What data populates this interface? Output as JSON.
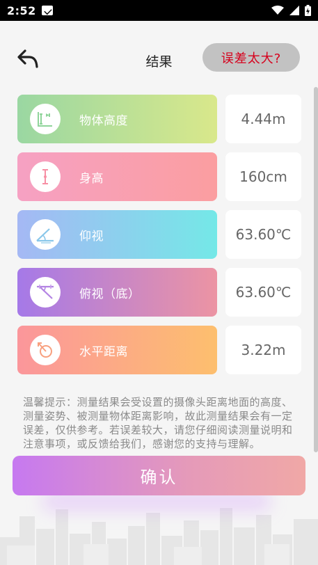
{
  "status_bar": {
    "time": "2:52",
    "icons": [
      "mail-icon",
      "wifi-icon",
      "signal-icon",
      "battery-icon"
    ]
  },
  "header": {
    "title": "结果",
    "error_button_label": "误差太大?",
    "back_icon": "back-arrow-icon"
  },
  "results": [
    {
      "label": "物体高度",
      "value": "4.44m",
      "icon": "object-height-icon"
    },
    {
      "label": "身高",
      "value": "160cm",
      "icon": "height-line-icon"
    },
    {
      "label": "仰视",
      "value": "63.60℃",
      "icon": "elevation-angle-icon"
    },
    {
      "label": "俯视（底）",
      "value": "63.60℃",
      "icon": "depression-angle-icon"
    },
    {
      "label": "水平距离",
      "value": "3.22m",
      "icon": "distance-icon"
    }
  ],
  "tip": "温馨提示：测量结果会受设置的摄像头距离地面的高度、测量姿势、被测量物体距离影响，故此测量结果会有一定误差，仅供参考。若误差较大，请您仔细阅读测量说明和注意事项，或反馈给我们，感谢您的支持与理解。",
  "confirm_label": "确认",
  "colors": {
    "error_text": "#d6001c",
    "row1": [
      "#9ad7a2",
      "#d9e88b"
    ],
    "row2": [
      "#f6a1c3",
      "#fb9ea0"
    ],
    "row3": [
      "#a5b8f4",
      "#74e8e7"
    ],
    "row4": [
      "#a579e8",
      "#ec94a3"
    ],
    "row5": [
      "#fb969b",
      "#fdbf6e"
    ]
  }
}
